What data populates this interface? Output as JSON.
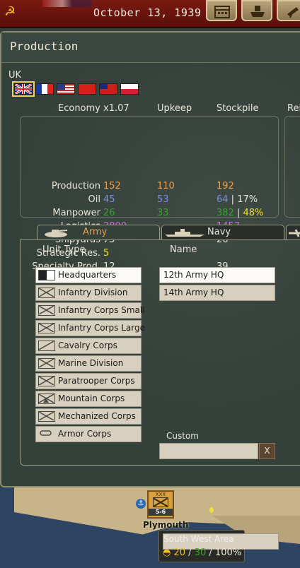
{
  "topbar": {
    "date": "October 13, 1939",
    "buttons": [
      {
        "icon": "calendar-icon"
      },
      {
        "icon": "ship-icon"
      },
      {
        "icon": "telescope-icon"
      }
    ]
  },
  "production": {
    "title": "Production",
    "nation": "UK",
    "flags": [
      {
        "name": "uk-flag",
        "selected": true
      },
      {
        "name": "france-flag"
      },
      {
        "name": "usa-flag"
      },
      {
        "name": "china-flag"
      },
      {
        "name": "canada-red-ensign-flag"
      },
      {
        "name": "poland-flag"
      }
    ],
    "economy": {
      "headers": {
        "economy": "Economy x1.07",
        "upkeep": "Upkeep",
        "stockpile": "Stockpile",
        "reinforce": "Rei"
      },
      "rows": [
        {
          "label": "Production",
          "v1": "152",
          "c1": "orange",
          "v2": "110",
          "c2": "orange",
          "v3": "192",
          "c3": "orange"
        },
        {
          "label": "Oil",
          "v1": "45",
          "c1": "blue",
          "v2": "53",
          "c2": "blue",
          "v3": "64",
          "c3": "blue",
          "sep": " | ",
          "extra": "17%",
          "cx": "light"
        },
        {
          "label": "Manpower",
          "v1": "26",
          "c1": "green",
          "v2": "33",
          "c2": "green",
          "v3": "382",
          "c3": "green",
          "sep": " | ",
          "extra": "48%",
          "cx": "yellow"
        },
        {
          "label": "Logistics",
          "v1": "2800",
          "c1": "purple",
          "v2": "",
          "c2": "",
          "v3": "1457",
          "c3": "purple"
        },
        {
          "label": "Shipyards",
          "v1": "75",
          "c1": "light",
          "v2": "",
          "c2": "",
          "v3": "26",
          "c3": "light"
        },
        {
          "label": "Strategic Res.",
          "v1": "5",
          "c1": "yellow",
          "v2": "",
          "c2": "",
          "v3": "",
          "c3": ""
        },
        {
          "label": "Specialty Prod.",
          "v1": "12",
          "c1": "light",
          "v2": "",
          "c2": "",
          "v3": "39",
          "c3": "light"
        }
      ]
    },
    "tabs": [
      {
        "label": "Army",
        "icon": "tank-icon",
        "active": true
      },
      {
        "label": "Navy",
        "icon": "battleship-icon",
        "active": false
      },
      {
        "label": "",
        "icon": "plane-icon",
        "active": false
      }
    ],
    "unit_type_header": "Unit Type",
    "name_header": "Name",
    "unit_types": [
      {
        "label": "Headquarters",
        "icon": "hq-icon",
        "selected": true
      },
      {
        "label": "Infantry Division",
        "icon": "infantry-icon"
      },
      {
        "label": "Infantry Corps Small",
        "icon": "infantry-icon"
      },
      {
        "label": "Infantry Corps Large",
        "icon": "infantry-icon"
      },
      {
        "label": "Cavalry Corps",
        "icon": "cavalry-icon"
      },
      {
        "label": "Marine Division",
        "icon": "marine-icon"
      },
      {
        "label": "Paratrooper Corps",
        "icon": "paratrooper-icon"
      },
      {
        "label": "Mountain Corps",
        "icon": "mountain-icon"
      },
      {
        "label": "Mechanized Corps",
        "icon": "mechanized-icon"
      },
      {
        "label": "Armor Corps",
        "icon": "armor-icon"
      }
    ],
    "names": [
      {
        "label": "12th Army HQ",
        "selected": true
      },
      {
        "label": "14th Army HQ"
      }
    ],
    "custom_label": "Custom",
    "custom_value": "",
    "clear_label": "X"
  },
  "map": {
    "unit_counter": {
      "top": "XXX",
      "strength": "5-6"
    },
    "city": "Plymouth",
    "area": {
      "name": "South West Area",
      "v1": "20",
      "v2": "30",
      "v3": "100%",
      "c1": "#f0c020",
      "c2": "#3aa030",
      "c3": "#f0e8d8"
    }
  }
}
